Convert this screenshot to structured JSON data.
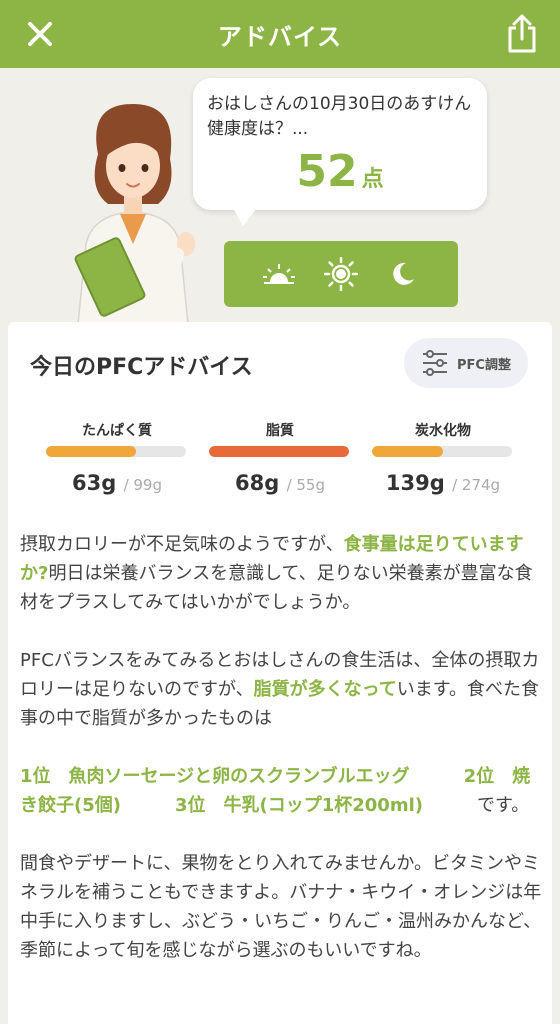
{
  "header": {
    "title": "アドバイス"
  },
  "bubble": {
    "question": "おはしさんの10月30日のあすけん健康度は？...",
    "score": "52",
    "score_unit": "点"
  },
  "card": {
    "title": "今日のPFCアドバイス",
    "pfc_button_label": "PFC調整",
    "nutrients": [
      {
        "label": "たんぱく質",
        "value": "63g",
        "max": "/ 99g",
        "fill_ratio": 0.64,
        "color": "#f0a73a"
      },
      {
        "label": "脂質",
        "value": "68g",
        "max": "/ 55g",
        "fill_ratio": 1.0,
        "color": "#e8693a"
      },
      {
        "label": "炭水化物",
        "value": "139g",
        "max": "/ 274g",
        "fill_ratio": 0.51,
        "color": "#f0a73a"
      }
    ],
    "paragraph1": {
      "a": "摂取カロリーが不足気味のようですが、",
      "b": "食事量は足りていますか?",
      "c": "明日は栄養バランスを意識して、足りない栄養素が豊富な食材をプラスしてみてはいかがでしょうか。"
    },
    "paragraph2": {
      "a": "PFCバランスをみてみるとおはしさんの食生活は、全体の摂取カロリーは足りないのですが、",
      "b": "脂質が多くなって",
      "c": "います。食べた食事の中で脂質が多かったものは"
    },
    "paragraph3": {
      "rank1": "1位　魚肉ソーセージと卵のスクランブルエッグ",
      "rank2": "2位　焼き餃子(5個)",
      "rank3": "3位　牛乳(コップ1杯200ml)",
      "tail": "です。"
    },
    "paragraph4": "間食やデザートに、果物をとり入れてみませんか。ビタミンやミネラルを補うこともできますよ。バナナ・キウイ・オレンジは年中手に入りますし、ぶどう・いちご・りんご・温州みかんなど、季節によって旬を感じながら選ぶのもいいですね。"
  },
  "colors": {
    "accent": "#8cb545",
    "protein": "#f0a73a",
    "fat": "#e8693a",
    "carb": "#f0a73a"
  }
}
